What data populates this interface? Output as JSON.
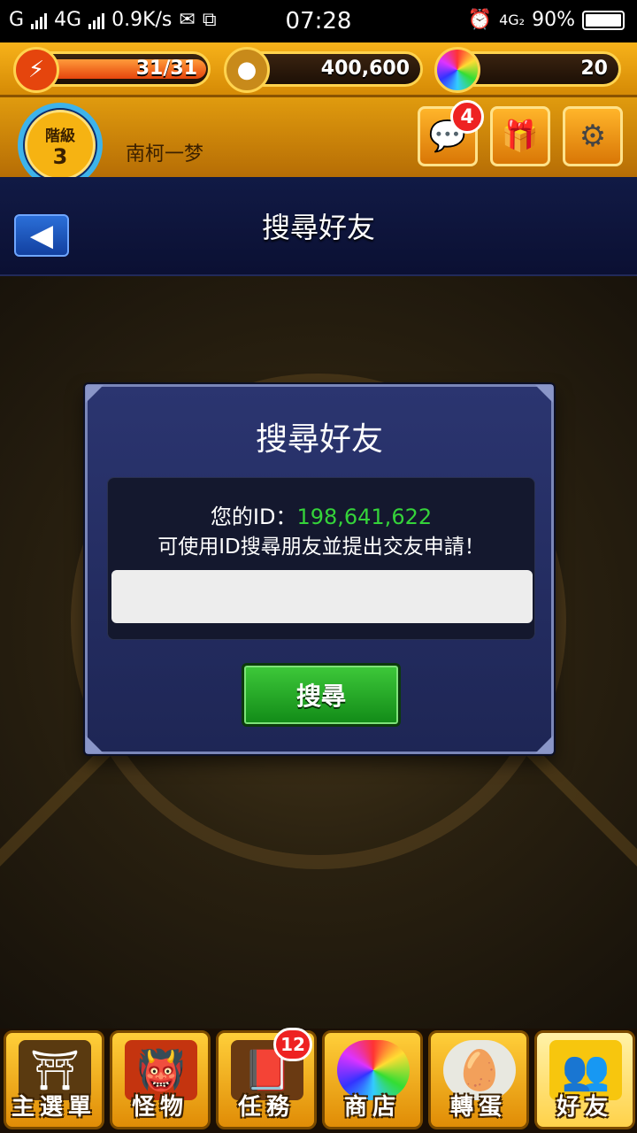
{
  "status_bar": {
    "carrier": "G",
    "network": "4G",
    "speed": "0.9K/s",
    "time": "07:28",
    "network2": "4G₂",
    "battery": "90%"
  },
  "resources": {
    "stamina": "31/31",
    "stamina_fraction": 1.0,
    "gold": "400,600",
    "orbs": "20"
  },
  "player": {
    "rank_label": "階級",
    "rank_value": "3",
    "name": "南柯一梦"
  },
  "header_buttons": {
    "chat_badge": "4",
    "chat_icon": "chat-bubble-icon",
    "gift_icon": "gift-icon",
    "settings_icon": "gear-icon"
  },
  "titlebar": {
    "title": "搜尋好友"
  },
  "dialog": {
    "title": "搜尋好友",
    "id_label": "您的ID：",
    "id_value": "198,641,622",
    "hint": "可使用ID搜尋朋友並提出交友申請！",
    "search_input_value": "",
    "search_button": "搜尋"
  },
  "bottom_nav": {
    "tabs": [
      {
        "label": "主選單",
        "icon": "gate-icon"
      },
      {
        "label": "怪物",
        "icon": "monster-icon"
      },
      {
        "label": "任務",
        "icon": "book-icon",
        "badge": "12"
      },
      {
        "label": "商店",
        "icon": "orb-icon"
      },
      {
        "label": "轉蛋",
        "icon": "egg-icon"
      },
      {
        "label": "好友",
        "icon": "friends-icon"
      }
    ],
    "active_index": 5
  },
  "colors": {
    "gold": "#f7b21a",
    "navy": "#111a45",
    "dialog": "#2b3570",
    "id_green": "#35d33a",
    "button_green": "#2fb52c"
  }
}
